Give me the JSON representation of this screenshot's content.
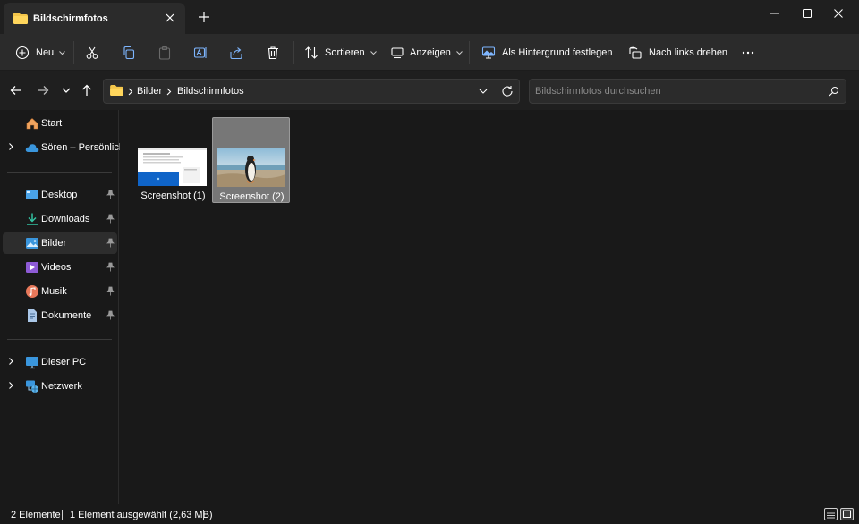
{
  "window": {
    "tab_title": "Bildschirmfotos",
    "controls": [
      "minimize",
      "maximize",
      "close"
    ]
  },
  "toolbar": {
    "new_label": "Neu",
    "sort_label": "Sortieren",
    "view_label": "Anzeigen",
    "set_background_label": "Als Hintergrund festlegen",
    "rotate_left_label": "Nach links drehen"
  },
  "address": {
    "crumbs": [
      "Bilder",
      "Bildschirmfotos"
    ],
    "search_placeholder": "Bildschirmfotos durchsuchen"
  },
  "sidebar": {
    "items": [
      {
        "label": "Start"
      },
      {
        "label": "Sören – Persönlich"
      },
      {
        "label": "Desktop"
      },
      {
        "label": "Downloads"
      },
      {
        "label": "Bilder"
      },
      {
        "label": "Videos"
      },
      {
        "label": "Musik"
      },
      {
        "label": "Dokumente"
      },
      {
        "label": "Dieser PC"
      },
      {
        "label": "Netzwerk"
      }
    ]
  },
  "files": [
    {
      "name": "Screenshot (1)",
      "selected": false
    },
    {
      "name": "Screenshot (2)",
      "selected": true
    }
  ],
  "status": {
    "count": "2 Elemente",
    "selection": "1 Element ausgewählt (2,63 MB)"
  },
  "colors": {
    "background": "#191919",
    "toolbar": "#2b2b2b",
    "accent_blue": "#0078d4",
    "folder_yellow": "#f3c54a"
  }
}
